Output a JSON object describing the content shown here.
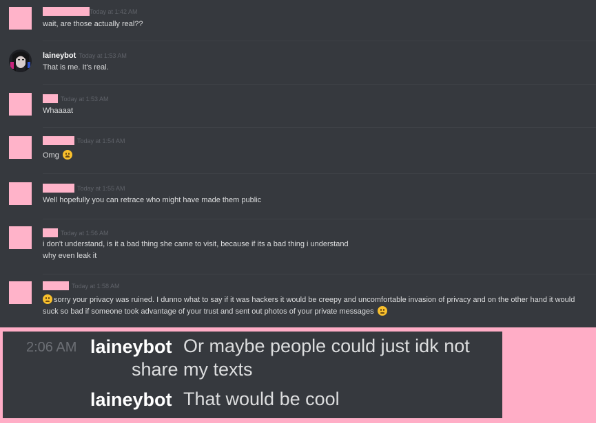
{
  "messages": [
    {
      "time": "Today at 1:42 AM",
      "text": "wait, are those actually real??"
    },
    {
      "username": "laineybot",
      "time": "Today at 1:53 AM",
      "text": "That is me. It's real."
    },
    {
      "time": "Today at 1:53 AM",
      "text": "Whaaaat"
    },
    {
      "time": "Today at 1:54 AM",
      "text": "Omg",
      "emoji": "weary-face-emoji"
    },
    {
      "time": "Today at 1:55 AM",
      "text": "Well hopefully you can retrace who might have made them public"
    },
    {
      "time": "Today at 1:56 AM",
      "text1": "i don't understand, is it a bad thing she came to visit, because if its a bad thing i understand",
      "text2": "why even leak it"
    },
    {
      "time": "Today at 1:58 AM",
      "emoji_start": "frowning-face-emoji",
      "text1": "sorry your privacy was ruined. I dunno what to say  if it was hackers it would be creepy and uncomfortable invasion of privacy and on the other hand  it would",
      "text2": "suck so bad if someone took advantage of your trust and sent out photos of your private messages",
      "emoji_end": "pensive-face-emoji"
    }
  ],
  "quote": {
    "time": "2:06 AM",
    "lines": [
      {
        "username": "laineybot",
        "text1": "Or maybe people could just idk not",
        "text2": "share my texts"
      },
      {
        "username": "laineybot",
        "text1": "That would be cool"
      }
    ]
  },
  "colors": {
    "background": "#36393e",
    "redaction": "#ffb3c9",
    "username": "#ffffff",
    "timestamp": "#5f6269",
    "text": "#dcddde"
  }
}
